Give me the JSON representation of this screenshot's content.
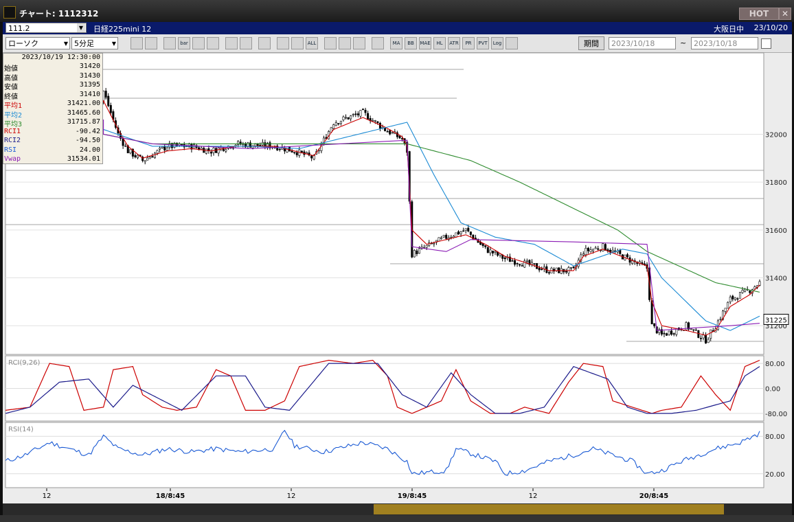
{
  "window": {
    "title": "チャート: 1112312",
    "hot_label": "HOT",
    "close_label": "✕"
  },
  "symbol_bar": {
    "code": "111.2",
    "name": "日経225mini 12",
    "market": "大阪日中",
    "date": "23/10/20"
  },
  "toolbar": {
    "chart_type": "ローソク",
    "interval": "5分足",
    "buttons": [
      "search",
      "crosshair",
      "candle",
      "bar",
      "line",
      "volume",
      "draw",
      "pointer",
      "undo",
      "split",
      "split2",
      "ALL",
      "settings",
      "tool",
      "color",
      "grid",
      "MA",
      "BB",
      "MAE",
      "HL",
      "ATR",
      "PR",
      "PVT",
      "Log",
      "print"
    ],
    "period_label": "期間",
    "from_date": "2023/10/18",
    "tilde": "~",
    "to_date": "2023/10/18"
  },
  "info_panel": {
    "datetime": "2023/10/19 12:30:00",
    "rows": [
      {
        "label": "始値",
        "value": "31420",
        "color": "#000000"
      },
      {
        "label": "高値",
        "value": "31430",
        "color": "#000000"
      },
      {
        "label": "安値",
        "value": "31395",
        "color": "#000000"
      },
      {
        "label": "終値",
        "value": "31410",
        "color": "#000000"
      },
      {
        "label": "平均1",
        "value": "31421.00",
        "color": "#cc0000"
      },
      {
        "label": "平均2",
        "value": "31465.60",
        "color": "#1a8ad4"
      },
      {
        "label": "平均3",
        "value": "31715.87",
        "color": "#2e8b2e"
      },
      {
        "label": "RCI1",
        "value": "-90.42",
        "color": "#cc0000"
      },
      {
        "label": "RCI2",
        "value": "-94.50",
        "color": "#1a1a8a"
      },
      {
        "label": "RSI",
        "value": "24.00",
        "color": "#1a5ad4"
      },
      {
        "label": "Vwap",
        "value": "31534.01",
        "color": "#8a1ab4"
      }
    ]
  },
  "chart_data": [
    {
      "type": "candlestick",
      "panel": "price",
      "x_tick_labels": [
        "12",
        "18/8:45",
        "12",
        "19/8:45",
        "12",
        "20/8:45"
      ],
      "y_tick_labels": [
        "32000",
        "31800",
        "31600",
        "31400",
        "31200"
      ],
      "ylim": [
        31080,
        32340
      ],
      "last_price_label": "31225",
      "close_path": [
        [
          0,
          31990
        ],
        [
          8,
          31950
        ],
        [
          18,
          31960
        ],
        [
          28,
          31990
        ],
        [
          36,
          32020
        ],
        [
          40,
          32180
        ],
        [
          46,
          32000
        ],
        [
          50,
          31930
        ],
        [
          56,
          31890
        ],
        [
          66,
          31950
        ],
        [
          76,
          31950
        ],
        [
          84,
          31930
        ],
        [
          94,
          31960
        ],
        [
          110,
          31950
        ],
        [
          118,
          31930
        ],
        [
          126,
          31900
        ],
        [
          134,
          32050
        ],
        [
          146,
          32090
        ],
        [
          155,
          32020
        ],
        [
          162,
          31980
        ],
        [
          164,
          31930
        ],
        [
          166,
          31500
        ],
        [
          172,
          31530
        ],
        [
          180,
          31570
        ],
        [
          188,
          31600
        ],
        [
          196,
          31520
        ],
        [
          204,
          31480
        ],
        [
          212,
          31460
        ],
        [
          222,
          31430
        ],
        [
          232,
          31430
        ],
        [
          236,
          31510
        ],
        [
          244,
          31530
        ],
        [
          254,
          31480
        ],
        [
          262,
          31440
        ],
        [
          264,
          31200
        ],
        [
          268,
          31160
        ],
        [
          278,
          31200
        ],
        [
          286,
          31140
        ],
        [
          290,
          31200
        ],
        [
          296,
          31310
        ],
        [
          304,
          31350
        ],
        [
          308,
          31380
        ]
      ],
      "moving_averages": [
        {
          "name": "平均1",
          "color": "#cc0000",
          "values": [
            [
              0,
              31990
            ],
            [
              8,
              31950
            ],
            [
              18,
              31960
            ],
            [
              28,
              31990
            ],
            [
              36,
              32020
            ],
            [
              40,
              32140
            ],
            [
              46,
              32020
            ],
            [
              50,
              31950
            ],
            [
              56,
              31900
            ],
            [
              66,
              31930
            ],
            [
              76,
              31940
            ],
            [
              84,
              31930
            ],
            [
              94,
              31950
            ],
            [
              110,
              31950
            ],
            [
              118,
              31930
            ],
            [
              126,
              31910
            ],
            [
              134,
              32020
            ],
            [
              146,
              32070
            ],
            [
              155,
              32030
            ],
            [
              162,
              31990
            ],
            [
              164,
              31950
            ],
            [
              166,
              31600
            ],
            [
              172,
              31540
            ],
            [
              180,
              31560
            ],
            [
              188,
              31580
            ],
            [
              196,
              31540
            ],
            [
              204,
              31490
            ],
            [
              212,
              31465
            ],
            [
              222,
              31430
            ],
            [
              232,
              31430
            ],
            [
              236,
              31490
            ],
            [
              244,
              31520
            ],
            [
              254,
              31480
            ],
            [
              262,
              31450
            ],
            [
              264,
              31300
            ],
            [
              268,
              31200
            ],
            [
              278,
              31180
            ],
            [
              286,
              31160
            ],
            [
              290,
              31180
            ],
            [
              296,
              31280
            ],
            [
              304,
              31330
            ],
            [
              308,
              31370
            ]
          ]
        },
        {
          "name": "平均2",
          "color": "#1a8ad4",
          "values": [
            [
              0,
              31960
            ],
            [
              20,
              31960
            ],
            [
              40,
              32020
            ],
            [
              60,
              31950
            ],
            [
              80,
              31950
            ],
            [
              100,
              31950
            ],
            [
              120,
              31940
            ],
            [
              140,
              31990
            ],
            [
              164,
              32050
            ],
            [
              175,
              31830
            ],
            [
              186,
              31630
            ],
            [
              200,
              31570
            ],
            [
              216,
              31540
            ],
            [
              232,
              31450
            ],
            [
              252,
              31520
            ],
            [
              262,
              31500
            ],
            [
              268,
              31400
            ],
            [
              278,
              31300
            ],
            [
              286,
              31220
            ],
            [
              296,
              31180
            ],
            [
              308,
              31240
            ]
          ]
        },
        {
          "name": "平均3",
          "color": "#2e8b2e",
          "values": [
            [
              0,
              31960
            ],
            [
              30,
              32020
            ],
            [
              60,
              31960
            ],
            [
              100,
              31960
            ],
            [
              130,
              31960
            ],
            [
              164,
              31960
            ],
            [
              190,
              31890
            ],
            [
              210,
              31800
            ],
            [
              230,
              31700
            ],
            [
              250,
              31600
            ],
            [
              262,
              31510
            ],
            [
              290,
              31380
            ],
            [
              308,
              31340
            ]
          ]
        }
      ],
      "vwap": {
        "name": "Vwap",
        "color": "#8a1ab4",
        "values": [
          [
            0,
            32080
          ],
          [
            40,
            32060
          ],
          [
            40,
            32000
          ],
          [
            60,
            31960
          ],
          [
            100,
            31940
          ],
          [
            164,
            31975
          ],
          [
            166,
            31530
          ],
          [
            180,
            31510
          ],
          [
            190,
            31560
          ],
          [
            232,
            31550
          ],
          [
            262,
            31540
          ],
          [
            266,
            31180
          ],
          [
            280,
            31190
          ],
          [
            296,
            31200
          ],
          [
            308,
            31210
          ]
        ]
      }
    },
    {
      "type": "line",
      "panel": "RCI",
      "title": "RCI(9,26)",
      "y_tick_labels": [
        "80.00",
        "0.00",
        "-80.00"
      ],
      "ylim": [
        -100,
        100
      ],
      "series": [
        {
          "name": "RCI1",
          "color": "#cc0000",
          "values": [
            [
              0,
              -70
            ],
            [
              10,
              -60
            ],
            [
              18,
              80
            ],
            [
              26,
              70
            ],
            [
              32,
              -70
            ],
            [
              40,
              -60
            ],
            [
              44,
              60
            ],
            [
              52,
              70
            ],
            [
              56,
              -20
            ],
            [
              64,
              -60
            ],
            [
              70,
              -70
            ],
            [
              78,
              -60
            ],
            [
              86,
              60
            ],
            [
              92,
              40
            ],
            [
              98,
              -70
            ],
            [
              106,
              -70
            ],
            [
              114,
              -40
            ],
            [
              120,
              70
            ],
            [
              132,
              90
            ],
            [
              142,
              80
            ],
            [
              150,
              90
            ],
            [
              156,
              40
            ],
            [
              160,
              -60
            ],
            [
              166,
              -80
            ],
            [
              172,
              -60
            ],
            [
              178,
              -40
            ],
            [
              184,
              60
            ],
            [
              190,
              -40
            ],
            [
              198,
              -80
            ],
            [
              206,
              -80
            ],
            [
              212,
              -60
            ],
            [
              222,
              -80
            ],
            [
              230,
              20
            ],
            [
              236,
              80
            ],
            [
              244,
              70
            ],
            [
              248,
              -40
            ],
            [
              256,
              -60
            ],
            [
              264,
              -80
            ],
            [
              268,
              -70
            ],
            [
              276,
              -60
            ],
            [
              284,
              40
            ],
            [
              290,
              -20
            ],
            [
              296,
              -70
            ],
            [
              302,
              70
            ],
            [
              308,
              90
            ]
          ]
        },
        {
          "name": "RCI2",
          "color": "#1a1a8a",
          "values": [
            [
              0,
              -80
            ],
            [
              10,
              -60
            ],
            [
              22,
              20
            ],
            [
              34,
              30
            ],
            [
              44,
              -60
            ],
            [
              52,
              10
            ],
            [
              62,
              -30
            ],
            [
              72,
              -70
            ],
            [
              86,
              40
            ],
            [
              98,
              40
            ],
            [
              106,
              -60
            ],
            [
              116,
              -70
            ],
            [
              132,
              80
            ],
            [
              152,
              80
            ],
            [
              162,
              -20
            ],
            [
              172,
              -60
            ],
            [
              182,
              50
            ],
            [
              190,
              -20
            ],
            [
              200,
              -80
            ],
            [
              210,
              -80
            ],
            [
              220,
              -60
            ],
            [
              232,
              70
            ],
            [
              246,
              30
            ],
            [
              254,
              -60
            ],
            [
              262,
              -80
            ],
            [
              272,
              -80
            ],
            [
              282,
              -70
            ],
            [
              296,
              -40
            ],
            [
              302,
              40
            ],
            [
              308,
              70
            ]
          ]
        }
      ]
    },
    {
      "type": "line",
      "panel": "RSI",
      "title": "RSI(14)",
      "y_tick_labels": [
        "80.00",
        "20.00"
      ],
      "ylim": [
        0,
        100
      ],
      "series": [
        {
          "name": "RSI",
          "color": "#1a5ad4",
          "values": [
            [
              0,
              40
            ],
            [
              8,
              50
            ],
            [
              18,
              70
            ],
            [
              26,
              60
            ],
            [
              34,
              50
            ],
            [
              40,
              80
            ],
            [
              46,
              60
            ],
            [
              56,
              50
            ],
            [
              66,
              60
            ],
            [
              76,
              55
            ],
            [
              86,
              60
            ],
            [
              96,
              55
            ],
            [
              110,
              60
            ],
            [
              114,
              90
            ],
            [
              118,
              65
            ],
            [
              130,
              55
            ],
            [
              146,
              70
            ],
            [
              156,
              60
            ],
            [
              164,
              40
            ],
            [
              166,
              20
            ],
            [
              180,
              25
            ],
            [
              184,
              60
            ],
            [
              192,
              50
            ],
            [
              200,
              40
            ],
            [
              204,
              20
            ],
            [
              212,
              25
            ],
            [
              222,
              40
            ],
            [
              232,
              50
            ],
            [
              240,
              60
            ],
            [
              248,
              50
            ],
            [
              256,
              40
            ],
            [
              262,
              20
            ],
            [
              268,
              25
            ],
            [
              276,
              40
            ],
            [
              290,
              60
            ],
            [
              300,
              70
            ],
            [
              308,
              85
            ]
          ]
        }
      ]
    }
  ]
}
